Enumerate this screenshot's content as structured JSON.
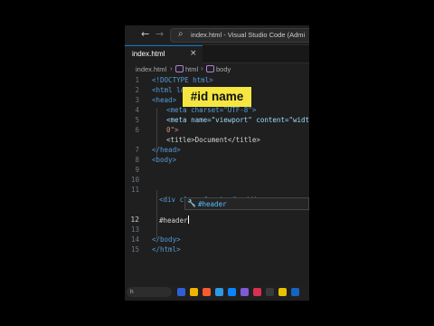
{
  "window": {
    "title": "index.html - Visual Studio Code (Admi",
    "nav_back": "←",
    "nav_forward": "→"
  },
  "tab": {
    "label": "index.html",
    "close": "×"
  },
  "breadcrumb": [
    "index.html",
    "html",
    "body"
  ],
  "overlay": "#id name",
  "editor": {
    "line_numbers": [
      "1",
      "2",
      "3",
      "4",
      "5",
      "6",
      "",
      "7",
      "8",
      "9",
      "10",
      "11",
      "12",
      "13",
      "14",
      "15"
    ],
    "active_line": "12",
    "lines": [
      "<!DOCTYPE html>",
      "<html lang=\"en\">",
      "<head>",
      "<meta charset=\"UTF-8\">",
      "<meta name=\"viewport\" content=\"width",
      "0\">",
      "<title>Document</title>",
      "</head>",
      "<body>",
      "<div class=\"navbar\"></div>",
      "#header",
      "</body>",
      "</html>"
    ]
  },
  "suggestion": {
    "icon": "wrench-icon",
    "text": "#header"
  },
  "taskbar": {
    "search_label": "h"
  },
  "colors": {
    "accent": "#0078d4",
    "overlay_bg": "#f5e642",
    "tag": "#569cd6",
    "attr": "#9cdcfe",
    "string": "#ce9178"
  }
}
